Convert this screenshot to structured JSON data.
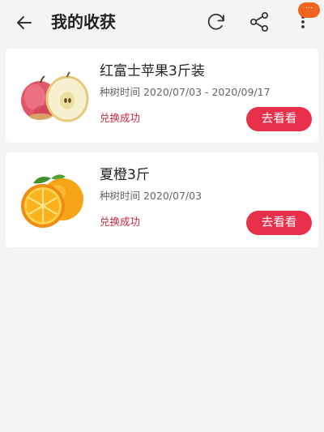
{
  "header": {
    "title": "我的收获",
    "icons": [
      "back-icon",
      "refresh-icon",
      "share-icon",
      "more-icon"
    ],
    "badge": "···"
  },
  "colors": {
    "accent": "#e8304a",
    "status": "#c8283c",
    "badge": "#f0641e",
    "background": "#f4f4f4"
  },
  "items": [
    {
      "title": "红富士苹果3斤装",
      "period": "种树时间 2020/07/03 - 2020/09/17",
      "status": "兑换成功",
      "button": "去看看",
      "image": "apple-image"
    },
    {
      "title": "夏橙3斤",
      "period": "种树时间 2020/07/03",
      "status": "兑换成功",
      "button": "去看看",
      "image": "orange-image"
    }
  ]
}
